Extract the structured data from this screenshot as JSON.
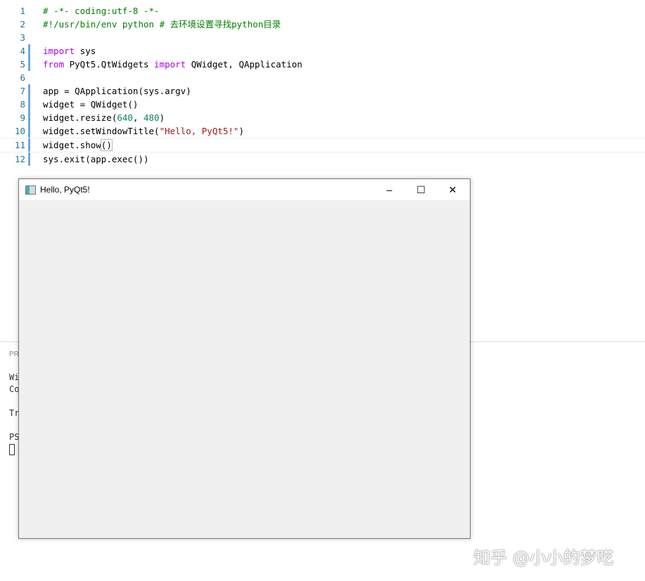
{
  "editor": {
    "lines": [
      {
        "n": "1",
        "parts": [
          {
            "t": "# -*- coding:utf-8 -*-",
            "c": "cm"
          }
        ]
      },
      {
        "n": "2",
        "parts": [
          {
            "t": "#!/usr/bin/env python # 去环境设置寻找python目录",
            "c": "cm"
          }
        ]
      },
      {
        "n": "3",
        "parts": []
      },
      {
        "n": "4",
        "mod": true,
        "parts": [
          {
            "t": "import",
            "c": "kw"
          },
          {
            "t": " sys",
            "c": ""
          }
        ]
      },
      {
        "n": "5",
        "mod": true,
        "parts": [
          {
            "t": "from",
            "c": "kw"
          },
          {
            "t": " PyQt5.QtWidgets ",
            "c": ""
          },
          {
            "t": "import",
            "c": "kw"
          },
          {
            "t": " QWidget, QApplication",
            "c": ""
          }
        ]
      },
      {
        "n": "6",
        "parts": []
      },
      {
        "n": "7",
        "mod": true,
        "parts": [
          {
            "t": "app = QApplication(sys.argv)",
            "c": ""
          }
        ]
      },
      {
        "n": "8",
        "mod": true,
        "parts": [
          {
            "t": "widget = QWidget()",
            "c": ""
          }
        ]
      },
      {
        "n": "9",
        "mod": true,
        "parts": [
          {
            "t": "widget.resize(",
            "c": ""
          },
          {
            "t": "640",
            "c": "num"
          },
          {
            "t": ", ",
            "c": ""
          },
          {
            "t": "480",
            "c": "num"
          },
          {
            "t": ")",
            "c": ""
          }
        ]
      },
      {
        "n": "10",
        "mod": true,
        "parts": [
          {
            "t": "widget.setWindowTitle(",
            "c": ""
          },
          {
            "t": "\"Hello, PyQt5!\"",
            "c": "str"
          },
          {
            "t": ")",
            "c": ""
          }
        ]
      },
      {
        "n": "11",
        "mod": true,
        "current": true,
        "parts": [
          {
            "t": "widget.show",
            "c": ""
          },
          {
            "t": "()",
            "c": "bracket"
          }
        ]
      },
      {
        "n": "12",
        "mod": true,
        "parts": [
          {
            "t": "sys.exit(app.exec())",
            "c": ""
          }
        ]
      }
    ]
  },
  "terminal": {
    "header": "PR",
    "lines": [
      "Wi",
      "Co",
      "Tr",
      "PS"
    ]
  },
  "window": {
    "title": "Hello, PyQt5!",
    "minimize": "–",
    "maximize": "☐",
    "close": "✕"
  },
  "watermark": "知乎 @小小的梦呓"
}
